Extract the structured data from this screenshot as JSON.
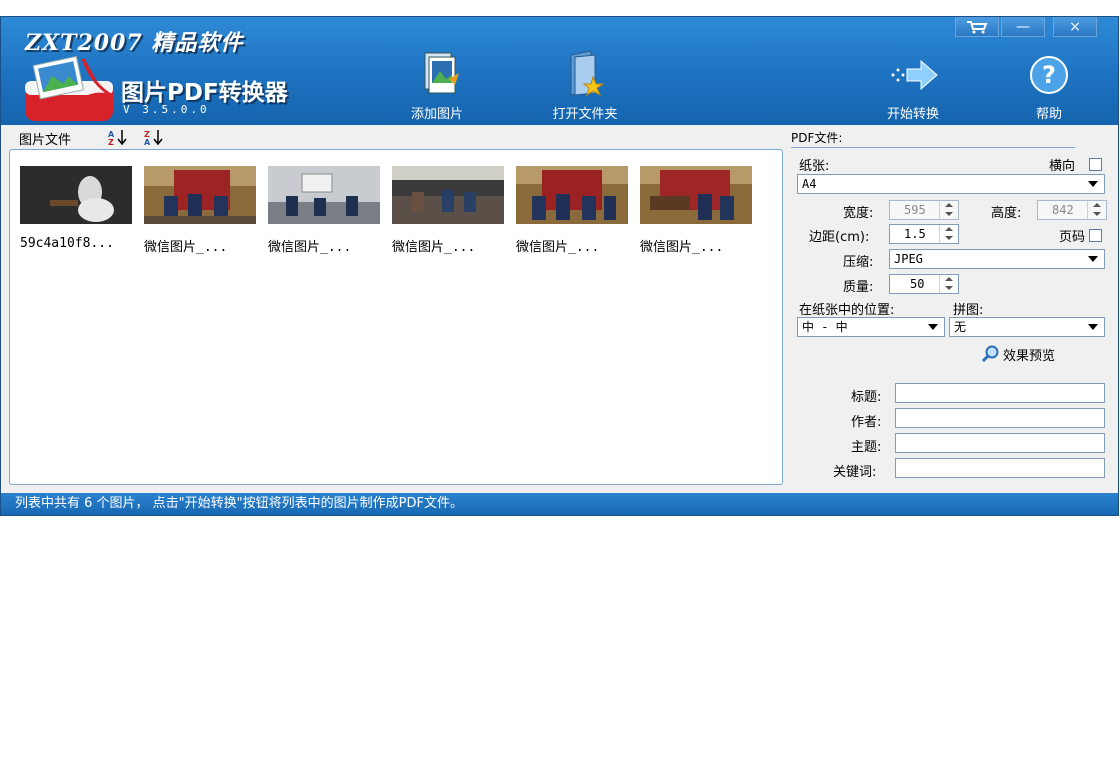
{
  "window": {
    "brand": "ZXT2007 精品软件",
    "app_title": "图片PDF转换器",
    "version": "V 3.5.0.0",
    "controls": {
      "cart": "cart-icon",
      "minimize": "—",
      "close": "×"
    }
  },
  "toolbar": {
    "add_images": "添加图片",
    "open_folder": "打开文件夹",
    "start_convert": "开始转换",
    "help": "帮助"
  },
  "file_list": {
    "header_label": "图片文件",
    "sort_asc_icon": "sort-az-icon",
    "sort_desc_icon": "sort-za-icon",
    "items": [
      {
        "name": "59c4a10f8..."
      },
      {
        "name": "微信图片_..."
      },
      {
        "name": "微信图片_..."
      },
      {
        "name": "微信图片_..."
      },
      {
        "name": "微信图片_..."
      },
      {
        "name": "微信图片_..."
      }
    ]
  },
  "settings": {
    "section_title": "PDF文件:",
    "paper_label": "纸张:",
    "landscape_label": "横向",
    "paper_value": "A4",
    "width_label": "宽度:",
    "width_value": "595",
    "height_label": "高度:",
    "height_value": "842",
    "margin_label": "边距(cm):",
    "margin_value": "1.5",
    "page_number_label": "页码",
    "compression_label": "压缩:",
    "compression_value": "JPEG",
    "quality_label": "质量:",
    "quality_value": "50",
    "position_label": "在纸张中的位置:",
    "position_value": "中 - 中",
    "collage_label": "拼图:",
    "collage_value": "无",
    "preview_label": "效果预览",
    "title_label": "标题:",
    "author_label": "作者:",
    "subject_label": "主题:",
    "keywords_label": "关键词:",
    "title_value": "",
    "author_value": "",
    "subject_value": "",
    "keywords_value": ""
  },
  "status": {
    "text": "列表中共有 6 个图片，  点击\"开始转换\"按钮将列表中的图片制作成PDF文件。"
  },
  "colors": {
    "header_blue": "#1e74c2",
    "status_blue": "#1868b3",
    "border_blue": "#7aa7d4"
  }
}
